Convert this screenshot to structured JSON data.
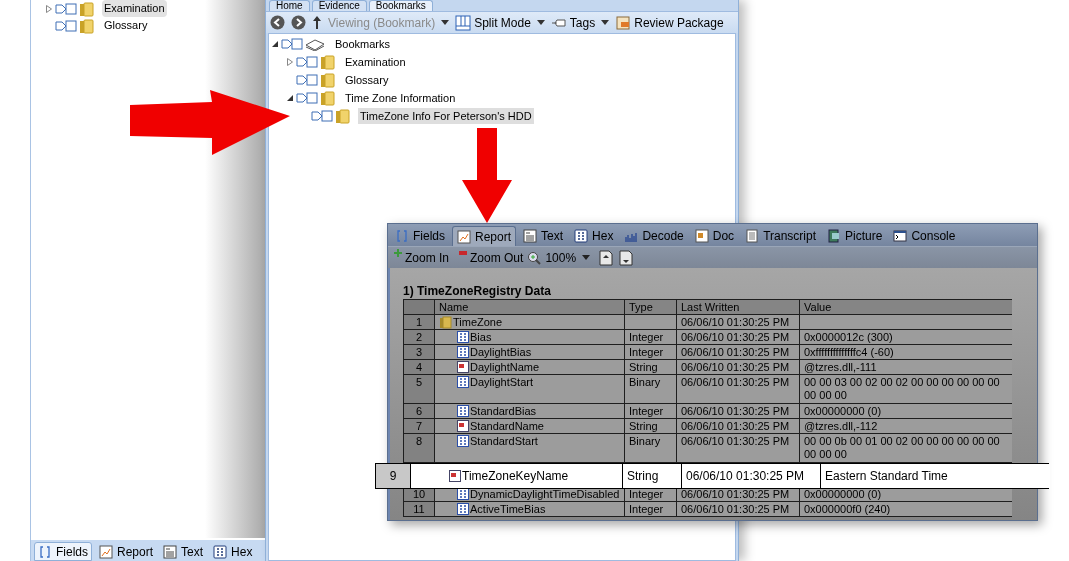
{
  "left_panel": {
    "tree": [
      {
        "label": "Examination",
        "selected": true,
        "expanded": false
      },
      {
        "label": "Glossary",
        "selected": false
      }
    ],
    "bottom_tabs": [
      {
        "label": "Fields",
        "selected": true
      },
      {
        "label": "Report",
        "selected": false
      },
      {
        "label": "Text",
        "selected": false
      },
      {
        "label": "Hex",
        "selected": false
      }
    ]
  },
  "bookmarks_window": {
    "tabs": [
      {
        "label": "Home",
        "selected": false
      },
      {
        "label": "Evidence",
        "selected": false
      },
      {
        "label": "Bookmarks",
        "selected": true
      }
    ],
    "toolbar": [
      {
        "label": "Viewing (Bookmark)",
        "disabled": true,
        "dropdown": true
      },
      {
        "label": "Split Mode",
        "disabled": false,
        "dropdown": true
      },
      {
        "label": "Tags",
        "disabled": false,
        "dropdown": true
      },
      {
        "label": "Review Package",
        "disabled": false,
        "dropdown": false
      }
    ],
    "tree": [
      {
        "label": "Bookmarks",
        "kind": "book",
        "selected": false,
        "expanded": true,
        "children": [
          {
            "label": "Examination",
            "kind": "folder",
            "selected": false,
            "expanded": false
          },
          {
            "label": "Glossary",
            "kind": "folder",
            "selected": false
          },
          {
            "label": "Time Zone Information",
            "kind": "folder",
            "selected": false,
            "expanded": true,
            "children": [
              {
                "label": "TimeZone Info For Peterson's HDD",
                "kind": "folder",
                "selected": true
              }
            ]
          }
        ]
      }
    ]
  },
  "report_panel": {
    "tabs": [
      {
        "label": "Fields",
        "selected": false
      },
      {
        "label": "Report",
        "selected": true
      },
      {
        "label": "Text",
        "selected": false
      },
      {
        "label": "Hex",
        "selected": false
      },
      {
        "label": "Decode",
        "selected": false
      },
      {
        "label": "Doc",
        "selected": false
      },
      {
        "label": "Transcript",
        "selected": false
      },
      {
        "label": "Picture",
        "selected": false
      },
      {
        "label": "Console",
        "selected": false
      }
    ],
    "toolbar": {
      "zoom_in": "Zoom In",
      "zoom_out": "Zoom Out",
      "zoom_level": "100%"
    },
    "title": "1) TimeZoneRegistry Data",
    "table": {
      "columns": [
        "Name",
        "Type",
        "Last Written",
        "Value"
      ],
      "rows": [
        {
          "number": "1",
          "name": "TimeZone",
          "kind": "folder",
          "last_written": "06/06/10 01:30:25 PM",
          "highlighted": false,
          "children": [
            {
              "number": "2",
              "name": "Bias",
              "kind": "number",
              "type": "Integer",
              "last_written": "06/06/10 01:30:25 PM",
              "value": "0x0000012c (300)",
              "highlighted": false
            },
            {
              "number": "3",
              "name": "DaylightBias",
              "kind": "number",
              "type": "Integer",
              "last_written": "06/06/10 01:30:25 PM",
              "value": "0xffffffffffffffc4 (-60)",
              "highlighted": false
            },
            {
              "number": "4",
              "name": "DaylightName",
              "kind": "string",
              "type": "String",
              "last_written": "06/06/10 01:30:25 PM",
              "value": "@tzres.dll,-111",
              "highlighted": false
            },
            {
              "number": "5",
              "name": "DaylightStart",
              "kind": "number",
              "type": "Binary",
              "last_written": "06/06/10 01:30:25 PM",
              "value": "00 00 03 00 02 00 02 00 00 00 00 00 00 00 00 00",
              "highlighted": false
            },
            {
              "number": "6",
              "name": "StandardBias",
              "kind": "number",
              "type": "Integer",
              "last_written": "06/06/10 01:30:25 PM",
              "value": "0x00000000 (0)",
              "highlighted": false
            },
            {
              "number": "7",
              "name": "StandardName",
              "kind": "string",
              "type": "String",
              "last_written": "06/06/10 01:30:25 PM",
              "value": "@tzres.dll,-112",
              "highlighted": false
            },
            {
              "number": "8",
              "name": "StandardStart",
              "kind": "number",
              "type": "Binary",
              "last_written": "06/06/10 01:30:25 PM",
              "value": "00 00 0b 00 01 00 02 00 00 00 00 00 00 00 00 00",
              "highlighted": false
            },
            {
              "number": "9",
              "name": "TimeZoneKeyName",
              "kind": "string",
              "type": "String",
              "last_written": "06/06/10 01:30:25 PM",
              "value": "Eastern Standard Time",
              "highlighted": true
            },
            {
              "number": "10",
              "name": "DynamicDaylightTimeDisabled",
              "kind": "number",
              "type": "Integer",
              "last_written": "06/06/10 01:30:25 PM",
              "value": "0x00000000 (0)",
              "highlighted": false
            },
            {
              "number": "11",
              "name": "ActiveTimeBias",
              "kind": "number",
              "type": "Integer",
              "last_written": "06/06/10 01:30:25 PM",
              "value": "0x000000f0 (240)",
              "highlighted": false
            }
          ]
        }
      ]
    }
  }
}
